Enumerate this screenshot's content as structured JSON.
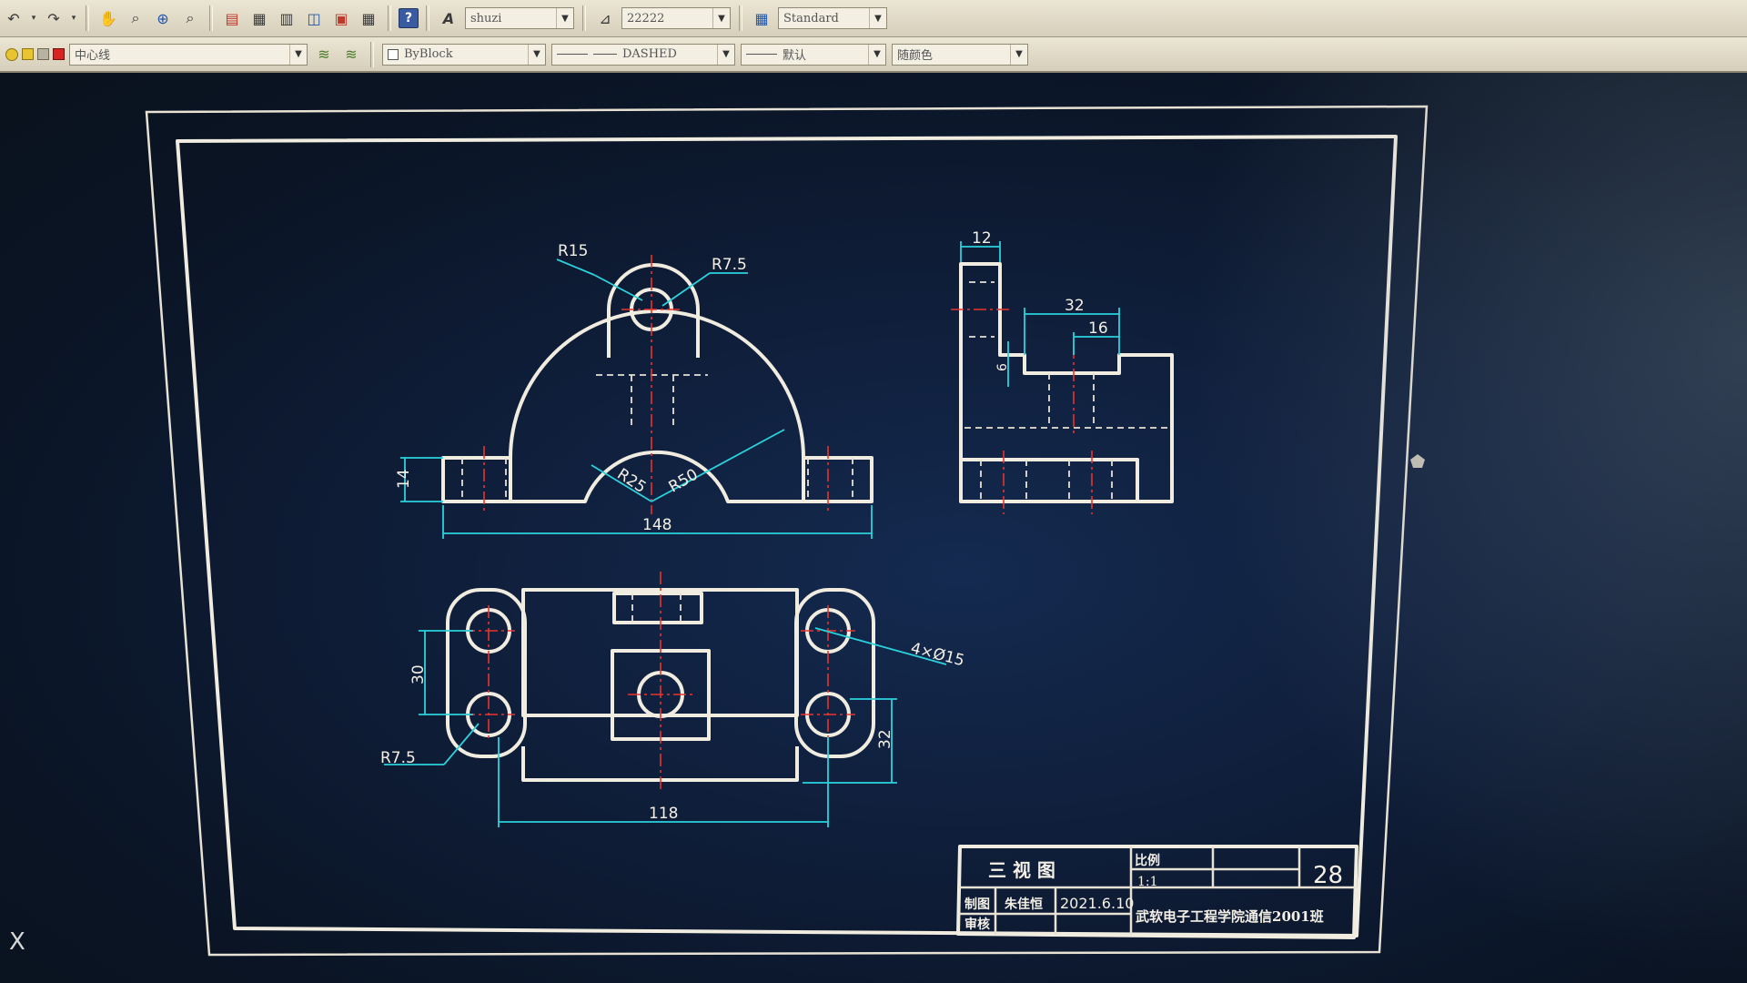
{
  "toolbar": {
    "text_style": "shuzi",
    "dim_style": "22222",
    "table_style": "Standard",
    "layer": "中心线",
    "color": "ByBlock",
    "linetype": "DASHED",
    "lineweight": "默认",
    "plot_style": "随颜色"
  },
  "dimensions": {
    "r15": "R15",
    "r7_5_top": "R7.5",
    "r25": "R25",
    "r50": "R50",
    "d14": "14",
    "d148": "148",
    "d12": "12",
    "d32_side": "32",
    "d16": "16",
    "d6": "6",
    "holes": "4×Ø15",
    "d30": "30",
    "r7_5_bottom": "R7.5",
    "d32_top": "32",
    "d118": "118"
  },
  "title_block": {
    "name": "三  视  图",
    "scale_label": "比例",
    "scale_value": "1:1",
    "drawing_no": "28",
    "drawn_by_label": "制图",
    "drawn_by": "朱佳恒",
    "date": "2021.6.10",
    "checked_label": "审核",
    "institution": "武软电子工程学院通信2001班"
  },
  "close_glyph": "X"
}
